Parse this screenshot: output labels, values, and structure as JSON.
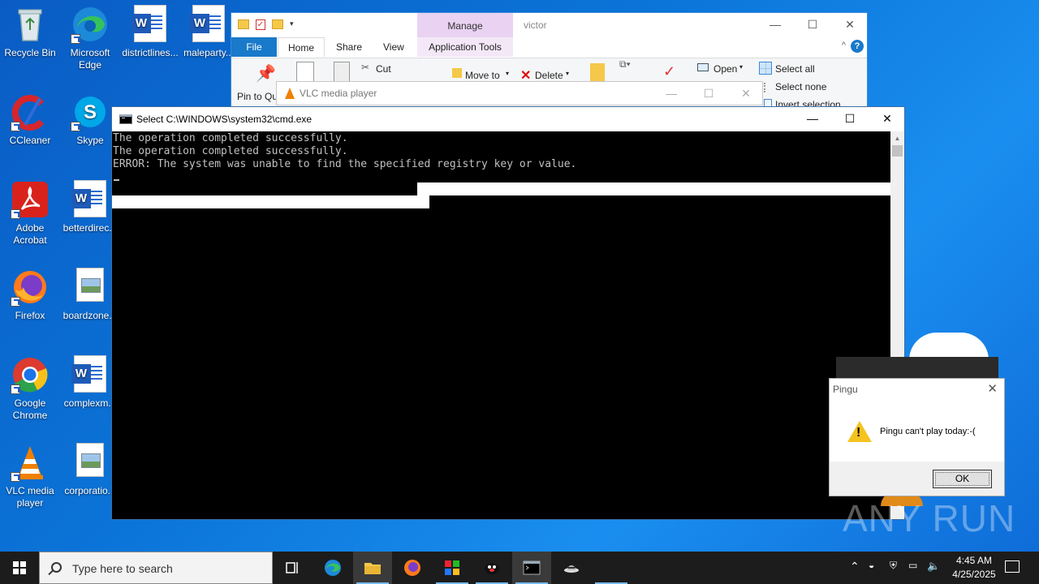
{
  "desktop": {
    "icons": [
      {
        "label": "Recycle Bin"
      },
      {
        "label": "Microsoft Edge"
      },
      {
        "label": "districtlines..."
      },
      {
        "label": "maleparty..."
      },
      {
        "label": "CCleaner"
      },
      {
        "label": "Skype"
      },
      {
        "label": "Adobe Acrobat"
      },
      {
        "label": "betterdirec..."
      },
      {
        "label": "Firefox"
      },
      {
        "label": "boardzone..."
      },
      {
        "label": "Google Chrome"
      },
      {
        "label": "complexm..."
      },
      {
        "label": "VLC media player"
      },
      {
        "label": "corporatio..."
      }
    ]
  },
  "explorer": {
    "manage_label": "Manage",
    "title": "victor",
    "tabs": {
      "file": "File",
      "home": "Home",
      "share": "Share",
      "view": "View",
      "app_tools": "Application Tools"
    },
    "ribbon": {
      "pin": "Pin to Qu...",
      "cut": "Cut",
      "move_to": "Move to",
      "delete": "Delete",
      "open": "Open",
      "select_all": "Select all",
      "select_none": "Select none",
      "invert_selection": "Invert selection"
    },
    "help": "?"
  },
  "vlc": {
    "title": "VLC media player"
  },
  "cmd": {
    "title": "Select C:\\WINDOWS\\system32\\cmd.exe",
    "lines": [
      "The operation completed successfully.",
      "The operation completed successfully.",
      "ERROR: The system was unable to find the specified registry key or value."
    ]
  },
  "dialog": {
    "title": "Pingu",
    "message": "Pingu can't play today:-(",
    "ok": "OK"
  },
  "watermark": "ANY RUN",
  "taskbar": {
    "search_placeholder": "Type here to search",
    "time": "4:45 AM",
    "date": "4/25/2025"
  },
  "colors": {
    "accent": "#1979ca",
    "manage_tab": "#e9d2f2",
    "taskbar": "#1c1c1c",
    "desktop": "#0b74d8"
  }
}
